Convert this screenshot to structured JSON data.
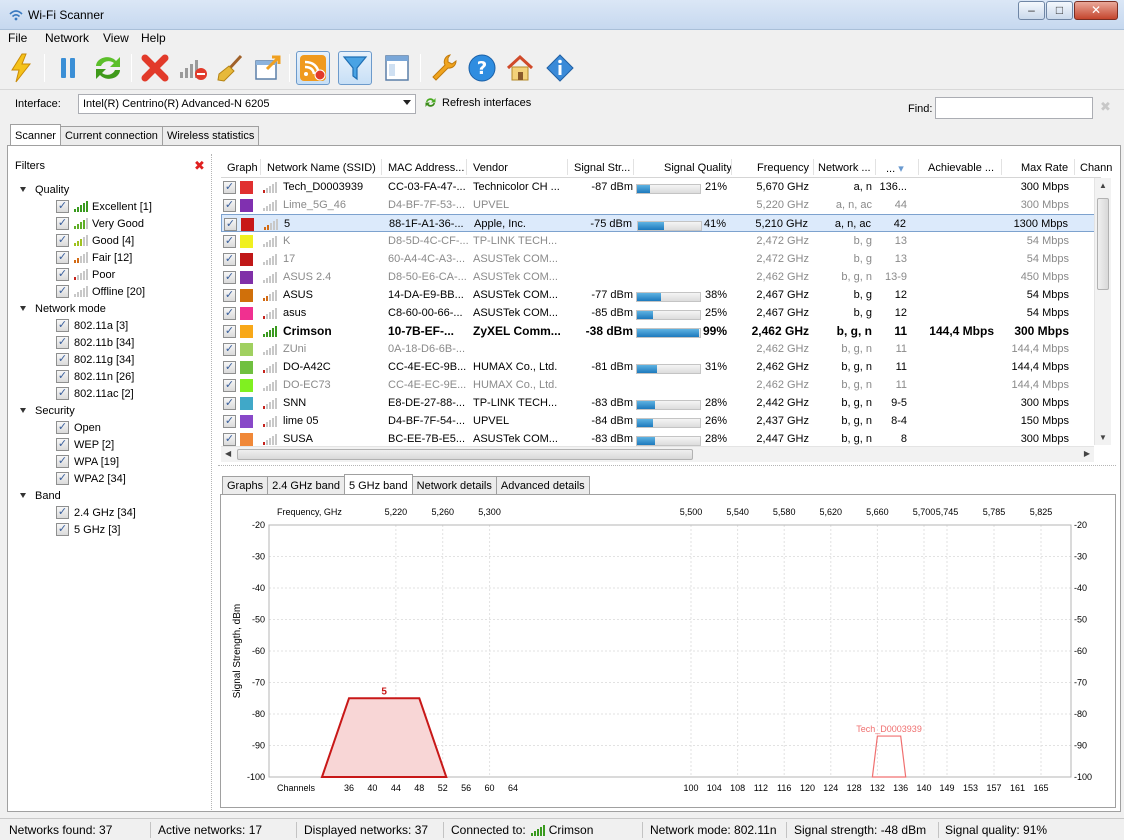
{
  "window": {
    "title": "Wi-Fi Scanner"
  },
  "menu": [
    "File",
    "Network",
    "View",
    "Help"
  ],
  "toolbar": [
    {
      "name": "start-scan-button",
      "icon": "lightning-icon"
    },
    {
      "name": "pause-button",
      "icon": "pause-icon"
    },
    {
      "name": "refresh-button",
      "icon": "refresh-icon"
    },
    {
      "name": "clear-button",
      "icon": "red-x-icon"
    },
    {
      "name": "signal-filter-button",
      "icon": "signal-remove-icon"
    },
    {
      "name": "cleanup-button",
      "icon": "broom-icon"
    },
    {
      "name": "export-button",
      "icon": "export-icon"
    },
    {
      "name": "connect-button",
      "icon": "wifi-connect-icon",
      "pressed": true
    },
    {
      "name": "filter-button",
      "icon": "funnel-icon",
      "pressed": true
    },
    {
      "name": "details-button",
      "icon": "window-icon"
    },
    {
      "name": "settings-button",
      "icon": "wrench-icon"
    },
    {
      "name": "help-button",
      "icon": "help-icon"
    },
    {
      "name": "home-button",
      "icon": "home-icon"
    },
    {
      "name": "about-button",
      "icon": "info-diamond-icon"
    }
  ],
  "interface": {
    "label": "Interface:",
    "value": "Intel(R) Centrino(R) Advanced-N 6205",
    "refresh_label": "Refresh interfaces",
    "find_label": "Find:",
    "find_value": ""
  },
  "main_tabs": [
    "Scanner",
    "Current connection",
    "Wireless statistics"
  ],
  "filters": {
    "title": "Filters",
    "groups": [
      {
        "label": "Quality",
        "items": [
          {
            "label": "Excellent [1]",
            "level": 5,
            "color": "#3a9a1f"
          },
          {
            "label": "Very Good",
            "level": 4,
            "color": "#5fae26"
          },
          {
            "label": "Good [4]",
            "level": 3,
            "color": "#9fc21f"
          },
          {
            "label": "Fair [12]",
            "level": 2,
            "color": "#d36b14"
          },
          {
            "label": "Poor",
            "level": 1,
            "color": "#c7231c"
          },
          {
            "label": "Offline [20]",
            "level": 0,
            "color": "#b8b8b8"
          }
        ]
      },
      {
        "label": "Network mode",
        "items": [
          {
            "label": "802.11a [3]"
          },
          {
            "label": "802.11b [34]"
          },
          {
            "label": "802.11g [34]"
          },
          {
            "label": "802.11n [26]"
          },
          {
            "label": "802.11ac [2]"
          }
        ]
      },
      {
        "label": "Security",
        "items": [
          {
            "label": "Open"
          },
          {
            "label": "WEP [2]"
          },
          {
            "label": "WPA [19]"
          },
          {
            "label": "WPA2 [34]"
          }
        ]
      },
      {
        "label": "Band",
        "items": [
          {
            "label": "2.4 GHz [34]"
          },
          {
            "label": "5 GHz [3]"
          }
        ]
      }
    ]
  },
  "table": {
    "columns": [
      "Graph",
      "Network Name (SSID)",
      "MAC Address...",
      "Vendor",
      "Signal Str...",
      "Signal Quality",
      "Frequency",
      "Network ...",
      "...",
      "Achievable ...",
      "Max Rate",
      "Chann"
    ],
    "rows": [
      {
        "color": "#e03030",
        "ssid": "Tech_D0003939",
        "mac": "CC-03-FA-47-...",
        "vendor": "Technicolor CH ...",
        "signal": "-87 dBm",
        "quality": 21,
        "quality_label": "21%",
        "freq": "5,670 GHz",
        "mode": "a, n",
        "ch": "136...",
        "ach": "",
        "rate": "300 Mbps",
        "level": 1,
        "bar_color": "#c7231c"
      },
      {
        "color": "#8030b0",
        "ssid": "Lime_5G_46",
        "mac": "D4-BF-7F-53-...",
        "vendor": "UPVEL",
        "signal": "",
        "quality": null,
        "quality_label": "",
        "freq": "5,220 GHz",
        "mode": "a, n, ac",
        "ch": "44",
        "ach": "",
        "rate": "300 Mbps",
        "offline": true
      },
      {
        "color": "#c81818",
        "ssid": "5",
        "mac": "88-1F-A1-36-...",
        "vendor": "Apple, Inc.",
        "signal": "-75 dBm",
        "quality": 41,
        "quality_label": "41%",
        "freq": "5,210 GHz",
        "mode": "a, n, ac",
        "ch": "42",
        "ach": "",
        "rate": "1300 Mbps",
        "selected": true,
        "level": 2,
        "bar_color": "#d36b14"
      },
      {
        "color": "#f0f020",
        "ssid": "K",
        "mac": "D8-5D-4C-CF-...",
        "vendor": "TP-LINK TECH...",
        "signal": "",
        "quality": null,
        "quality_label": "",
        "freq": "2,472 GHz",
        "mode": "b, g",
        "ch": "13",
        "ach": "",
        "rate": "54 Mbps",
        "offline": true
      },
      {
        "color": "#c01818",
        "ssid": "17",
        "mac": "60-A4-4C-A3-...",
        "vendor": "ASUSTek COM...",
        "signal": "",
        "quality": null,
        "quality_label": "",
        "freq": "2,472 GHz",
        "mode": "b, g",
        "ch": "13",
        "ach": "",
        "rate": "54 Mbps",
        "offline": true
      },
      {
        "color": "#8030a8",
        "ssid": "ASUS 2.4",
        "mac": "D8-50-E6-CA-...",
        "vendor": "ASUSTek COM...",
        "signal": "",
        "quality": null,
        "quality_label": "",
        "freq": "2,462 GHz",
        "mode": "b, g, n",
        "ch": "13-9",
        "ach": "",
        "rate": "450 Mbps",
        "offline": true
      },
      {
        "color": "#d0700a",
        "ssid": "ASUS",
        "mac": "14-DA-E9-BB...",
        "vendor": "ASUSTek COM...",
        "signal": "-77 dBm",
        "quality": 38,
        "quality_label": "38%",
        "freq": "2,467 GHz",
        "mode": "b, g",
        "ch": "12",
        "ach": "",
        "rate": "54 Mbps",
        "level": 2,
        "bar_color": "#d36b14"
      },
      {
        "color": "#f03090",
        "ssid": "asus",
        "mac": "C8-60-00-66-...",
        "vendor": "ASUSTek COM...",
        "signal": "-85 dBm",
        "quality": 25,
        "quality_label": "25%",
        "freq": "2,467 GHz",
        "mode": "b, g",
        "ch": "12",
        "ach": "",
        "rate": "54 Mbps",
        "level": 1,
        "bar_color": "#c7231c"
      },
      {
        "color": "#f8a818",
        "ssid": "Crimson",
        "mac": "10-7B-EF-...",
        "vendor": "ZyXEL Comm...",
        "signal": "-38 dBm",
        "quality": 99,
        "quality_label": "99%",
        "freq": "2,462 GHz",
        "mode": "b, g, n",
        "ch": "11",
        "ach": "144,4 Mbps",
        "rate": "300 Mbps",
        "bold": true,
        "level": 5,
        "bar_color": "#3a9a1f"
      },
      {
        "color": "#a0d060",
        "ssid": "ZUni",
        "mac": "0A-18-D6-6B-...",
        "vendor": "",
        "signal": "",
        "quality": null,
        "quality_label": "",
        "freq": "2,462 GHz",
        "mode": "b, g, n",
        "ch": "11",
        "ach": "",
        "rate": "144,4 Mbps",
        "offline": true
      },
      {
        "color": "#70c040",
        "ssid": "DO-A42C",
        "mac": "CC-4E-EC-9B...",
        "vendor": "HUMAX Co., Ltd.",
        "signal": "-81 dBm",
        "quality": 31,
        "quality_label": "31%",
        "freq": "2,462 GHz",
        "mode": "b, g, n",
        "ch": "11",
        "ach": "",
        "rate": "144,4 Mbps",
        "level": 1,
        "bar_color": "#c7231c"
      },
      {
        "color": "#80f020",
        "ssid": "DO-EC73",
        "mac": "CC-4E-EC-9E...",
        "vendor": "HUMAX Co., Ltd.",
        "signal": "",
        "quality": null,
        "quality_label": "",
        "freq": "2,462 GHz",
        "mode": "b, g, n",
        "ch": "11",
        "ach": "",
        "rate": "144,4 Mbps",
        "offline": true
      },
      {
        "color": "#40a8c8",
        "ssid": "SNN",
        "mac": "E8-DE-27-88-...",
        "vendor": "TP-LINK TECH...",
        "signal": "-83 dBm",
        "quality": 28,
        "quality_label": "28%",
        "freq": "2,442 GHz",
        "mode": "b, g, n",
        "ch": "9-5",
        "ach": "",
        "rate": "300 Mbps",
        "level": 1,
        "bar_color": "#c7231c"
      },
      {
        "color": "#8848c8",
        "ssid": "lime 05",
        "mac": "D4-BF-7F-54-...",
        "vendor": "UPVEL",
        "signal": "-84 dBm",
        "quality": 26,
        "quality_label": "26%",
        "freq": "2,437 GHz",
        "mode": "b, g, n",
        "ch": "8-4",
        "ach": "",
        "rate": "150 Mbps",
        "level": 1,
        "bar_color": "#c7231c"
      },
      {
        "color": "#f08838",
        "ssid": "SUSA",
        "mac": "BC-EE-7B-E5...",
        "vendor": "ASUSTek COM...",
        "signal": "-83 dBm",
        "quality": 28,
        "quality_label": "28%",
        "freq": "2,447 GHz",
        "mode": "b, g, n",
        "ch": "8",
        "ach": "",
        "rate": "300 Mbps",
        "level": 1,
        "bar_color": "#c7231c"
      }
    ]
  },
  "bottom_tabs": [
    "Graphs",
    "2.4 GHz band",
    "5 GHz band",
    "Network details",
    "Advanced details"
  ],
  "chart_data": {
    "type": "area",
    "frequency_label": "Frequency, GHz",
    "ylabel": "Signal Strength, dBm",
    "xlabel": "Channels",
    "ylim": [
      -100,
      -20
    ],
    "yticks": [
      -20,
      -30,
      -40,
      -50,
      -60,
      -70,
      -80,
      -90,
      -100
    ],
    "frequency_ticks": [
      {
        "label": "5,220",
        "channel": 44
      },
      {
        "label": "5,260",
        "channel": 52
      },
      {
        "label": "5,300",
        "channel": 60
      },
      {
        "label": "5,500",
        "channel": 100
      },
      {
        "label": "5,540",
        "channel": 108
      },
      {
        "label": "5,580",
        "channel": 116
      },
      {
        "label": "5,620",
        "channel": 124
      },
      {
        "label": "5,660",
        "channel": 132
      },
      {
        "label": "5,700",
        "channel": 140
      },
      {
        "label": "5,745",
        "channel": 149
      },
      {
        "label": "5,785",
        "channel": 157
      },
      {
        "label": "5,825",
        "channel": 165
      }
    ],
    "channels": [
      36,
      40,
      44,
      48,
      52,
      56,
      60,
      64,
      100,
      104,
      108,
      112,
      116,
      120,
      124,
      128,
      132,
      136,
      140,
      149,
      153,
      157,
      161,
      165
    ],
    "series": [
      {
        "name": "5",
        "signal": -75,
        "channel_from": 36,
        "channel_to": 48,
        "color": "#c81818",
        "fill": "#f8d6d6"
      },
      {
        "name": "Tech_D0003939",
        "signal": -87,
        "channel_from": 132,
        "channel_to": 136,
        "color": "#f07070",
        "fill": "none"
      }
    ]
  },
  "status": {
    "networks_found": "Networks found: 37",
    "active": "Active networks: 17",
    "displayed": "Displayed networks: 37",
    "connected_prefix": "Connected to:",
    "connected_name": "Crimson",
    "mode": "Network mode: 802.11n",
    "strength": "Signal strength: -48 dBm",
    "quality": "Signal quality: 91%"
  }
}
